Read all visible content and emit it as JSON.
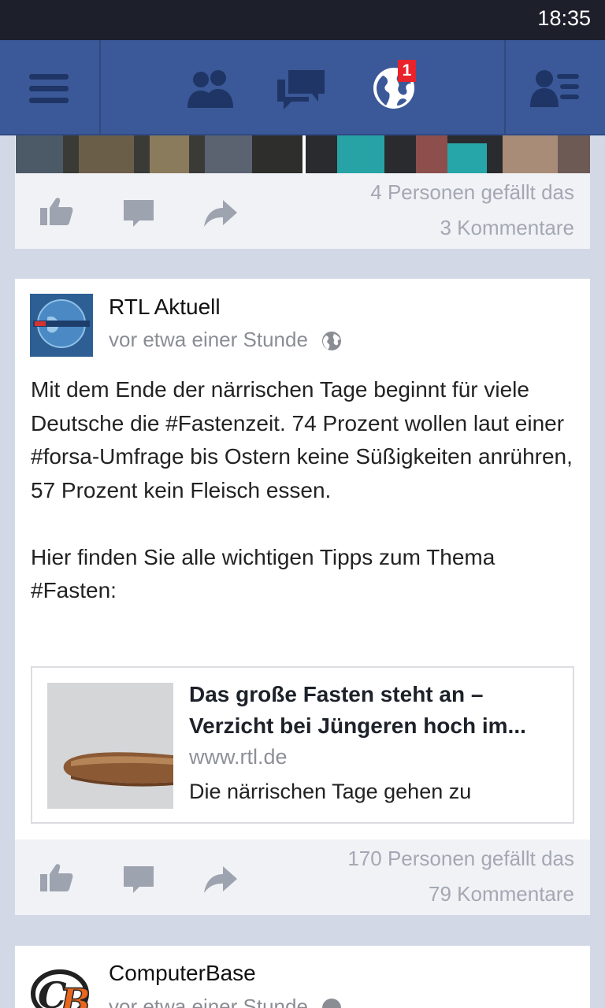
{
  "status_bar": {
    "time": "18:35"
  },
  "nav": {
    "menu_icon": "hamburger-icon",
    "friends_icon": "friend-requests-icon",
    "messages_icon": "messages-icon",
    "notifications_icon": "globe-notifications-icon",
    "notifications_badge": "1",
    "profile_icon": "profile-list-icon",
    "bar_color": "#3b5998",
    "badge_color": "#e8232b"
  },
  "posts": [
    {
      "likes_text": "4 Personen gefällt das",
      "comments_text": "3 Kommentare"
    },
    {
      "author": "RTL Aktuell",
      "time": "vor etwa einer Stunde",
      "privacy_icon": "globe-icon",
      "text": "Mit dem Ende der närrischen Tage beginnt für viele Deutsche die #Fastenzeit. 74 Prozent wollen laut einer #forsa-Umfrage bis Ostern keine Süßigkeiten anrühren, 57 Prozent kein Fleisch essen.\n\nHier finden Sie alle wichtigen Tipps zum Thema #Fasten:",
      "link": {
        "title_line1": "Das große Fasten steht an –",
        "title_line2": "Verzicht bei Jüngeren hoch im...",
        "domain": "www.rtl.de",
        "description": "Die närrischen Tage gehen zu"
      },
      "likes_text": "170 Personen gefällt das",
      "comments_text": "79 Kommentare"
    },
    {
      "author": "ComputerBase",
      "time": "vor etwa einer Stunde"
    }
  ],
  "actions": {
    "like_icon": "thumbs-up-icon",
    "comment_icon": "comment-icon",
    "share_icon": "share-arrow-icon"
  }
}
